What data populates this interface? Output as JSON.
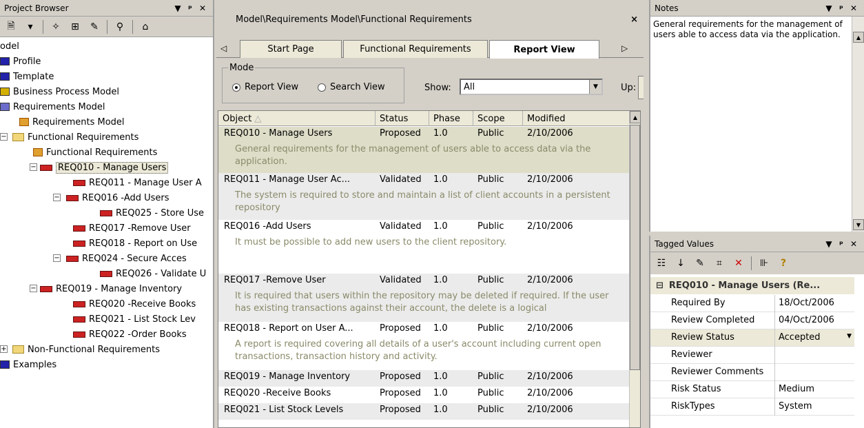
{
  "project_browser": {
    "title": "Project Browser",
    "tree": [
      {
        "label": "odel"
      },
      {
        "label": "Profile"
      },
      {
        "label": "Template"
      },
      {
        "label": "Business Process Model"
      },
      {
        "label": "Requirements Model"
      },
      {
        "label": "Requirements Model"
      },
      {
        "label": "Functional Requirements"
      },
      {
        "label": "Functional Requirements"
      },
      {
        "label": "REQ010 - Manage Users"
      },
      {
        "label": "REQ011 - Manage User A"
      },
      {
        "label": "REQ016 -Add Users"
      },
      {
        "label": "REQ025 - Store Use"
      },
      {
        "label": "REQ017 -Remove User"
      },
      {
        "label": "REQ018 - Report on Use"
      },
      {
        "label": "REQ024 - Secure Acces"
      },
      {
        "label": "REQ026 - Validate U"
      },
      {
        "label": "REQ019 - Manage Inventory"
      },
      {
        "label": "REQ020 -Receive Books"
      },
      {
        "label": "REQ021 - List Stock Lev"
      },
      {
        "label": "REQ022 -Order Books"
      },
      {
        "label": "Non-Functional Requirements"
      },
      {
        "label": "Examples"
      }
    ]
  },
  "center": {
    "path": "Model\\Requirements Model\\Functional Requirements",
    "tabs": [
      "Start Page",
      "Functional Requirements",
      "Report View"
    ],
    "active_tab": "Report View",
    "mode_label": "Mode",
    "mode_options": [
      "Report View",
      "Search View"
    ],
    "show_label": "Show:",
    "show_value": "All",
    "up_label": "Up:",
    "columns": [
      "Object",
      "Status",
      "Phase",
      "Scope",
      "Modified"
    ],
    "rows": [
      {
        "object": "REQ010 - Manage Users",
        "status": "Proposed",
        "phase": "1.0",
        "scope": "Public",
        "modified": "2/10/2006",
        "note": "General requirements for the management of users able to access data via the application."
      },
      {
        "object": "REQ011 - Manage User Ac...",
        "status": "Validated",
        "phase": "1.0",
        "scope": "Public",
        "modified": "2/10/2006",
        "note": "The system is required to store and maintain a list of client accounts in a persistent repository"
      },
      {
        "object": "REQ016 -Add Users",
        "status": "Validated",
        "phase": "1.0",
        "scope": "Public",
        "modified": "2/10/2006",
        "note": "It must be possible to add new users to the client repository."
      },
      {
        "object": "REQ017 -Remove User",
        "status": "Validated",
        "phase": "1.0",
        "scope": "Public",
        "modified": "2/10/2006",
        "note": "It is required that users within the repository may be deleted if required. If the user has existing transactions against their account, the delete is a logical"
      },
      {
        "object": "REQ018 - Report on User A...",
        "status": "Proposed",
        "phase": "1.0",
        "scope": "Public",
        "modified": "2/10/2006",
        "note": "A report is required covering all details of a user's account including current open transactions, transaction history and activity."
      },
      {
        "object": "REQ019 - Manage Inventory",
        "status": "Proposed",
        "phase": "1.0",
        "scope": "Public",
        "modified": "2/10/2006",
        "note": ""
      },
      {
        "object": "REQ020 -Receive Books",
        "status": "Proposed",
        "phase": "1.0",
        "scope": "Public",
        "modified": "2/10/2006",
        "note": ""
      },
      {
        "object": "REQ021 - List Stock Levels",
        "status": "Proposed",
        "phase": "1.0",
        "scope": "Public",
        "modified": "2/10/2006",
        "note": ""
      }
    ]
  },
  "notes": {
    "title": "Notes",
    "text": "General requirements for the management of users able to access data via the application."
  },
  "tagged_values": {
    "title": "Tagged Values",
    "group": "REQ010 - Manage Users (Re...",
    "props": [
      {
        "key": "Required By",
        "value": "18/Oct/2006"
      },
      {
        "key": "Review Completed",
        "value": "04/Oct/2006"
      },
      {
        "key": "Review Status",
        "value": "Accepted"
      },
      {
        "key": "Reviewer",
        "value": ""
      },
      {
        "key": "Reviewer Comments",
        "value": ""
      },
      {
        "key": "Risk Status",
        "value": "Medium"
      },
      {
        "key": "RiskTypes",
        "value": "System"
      }
    ]
  }
}
